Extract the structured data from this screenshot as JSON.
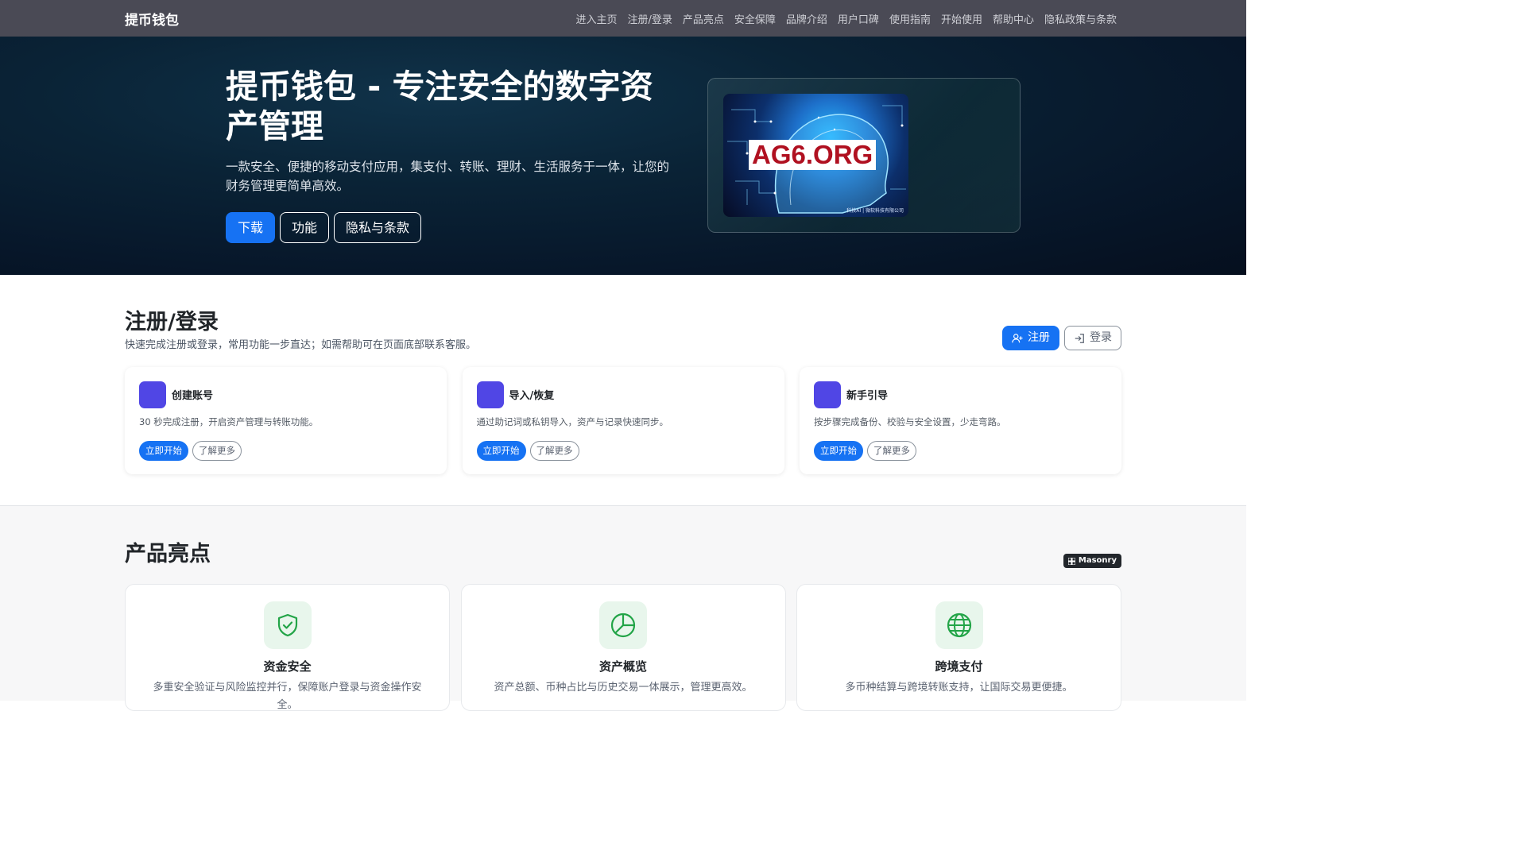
{
  "nav": {
    "brand": "提币钱包",
    "links": [
      "进入主页",
      "注册/登录",
      "产品亮点",
      "安全保障",
      "品牌介绍",
      "用户口碑",
      "使用指南",
      "开始使用",
      "帮助中心",
      "隐私政策与条款"
    ]
  },
  "hero": {
    "title": "提币钱包 - 专注安全的数字资产管理",
    "subtitle": "一款安全、便捷的移动支付应用，集支付、转账、理财、生活服务于一体，让您的财务管理更简单高效。",
    "buttons": [
      "下载",
      "功能",
      "隐私与条款"
    ],
    "image_label": "AG6.ORG",
    "image_footer": "科技AI | 微软科技有限公司"
  },
  "register": {
    "title": "注册/登录",
    "description": "快速完成注册或登录，常用功能一步直达；如需帮助可在页面底部联系客服。",
    "signup_label": "注册",
    "login_label": "登录",
    "cards": [
      {
        "title": "创建账号",
        "desc": "30 秒完成注册，开启资产管理与转账功能。",
        "primary": "立即开始",
        "secondary": "了解更多"
      },
      {
        "title": "导入/恢复",
        "desc": "通过助记词或私钥导入，资产与记录快速同步。",
        "primary": "立即开始",
        "secondary": "了解更多"
      },
      {
        "title": "新手引导",
        "desc": "按步骤完成备份、校验与安全设置，少走弯路。",
        "primary": "立即开始",
        "secondary": "了解更多"
      }
    ]
  },
  "features": {
    "title": "产品亮点",
    "badge": "Masonry",
    "items": [
      {
        "icon": "shield-check-icon",
        "title": "资金安全",
        "desc": "多重安全验证与风险监控并行，保障账户登录与资金操作安全。"
      },
      {
        "icon": "pie-chart-icon",
        "title": "资产概览",
        "desc": "资产总额、币种占比与历史交易一体展示，管理更高效。"
      },
      {
        "icon": "globe-icon",
        "title": "跨境支付",
        "desc": "多币种结算与跨境转账支持，让国际交易更便捷。"
      }
    ]
  },
  "colors": {
    "primary": "#1672f3",
    "nav_bg": "#4a4a55",
    "hero_bg": "#0a2336",
    "card_icon": "#5046e5",
    "feature_icon": "#22a447"
  }
}
